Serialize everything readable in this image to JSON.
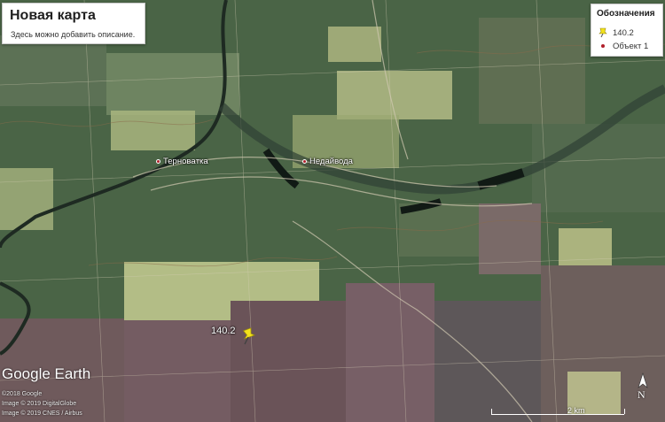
{
  "map": {
    "title": "Новая карта",
    "description": "Здесь можно добавить описание.",
    "legend": {
      "heading": "Обозначения",
      "items": [
        {
          "label": "140.2",
          "icon": "yellow-pushpin-icon",
          "color": "#f2e21b"
        },
        {
          "label": "Объект 1",
          "icon": "red-dot-icon",
          "color": "#b01f2a"
        }
      ]
    },
    "places": [
      {
        "name": "Терновaтка",
        "icon": "place-dot-icon"
      },
      {
        "name": "Недайвода",
        "icon": "place-dot-icon"
      }
    ],
    "placemark": {
      "label": "140.2",
      "icon": "yellow-pushpin-icon"
    },
    "branding": {
      "logo": "Google Earth",
      "credits": [
        "©2018 Google",
        "Image © 2019 DigitalGlobe",
        "Image © 2019 CNES / Airbus"
      ]
    },
    "scale": {
      "label": "2 km"
    },
    "compass": {
      "label": "N",
      "icon": "north-arrow-icon"
    }
  }
}
